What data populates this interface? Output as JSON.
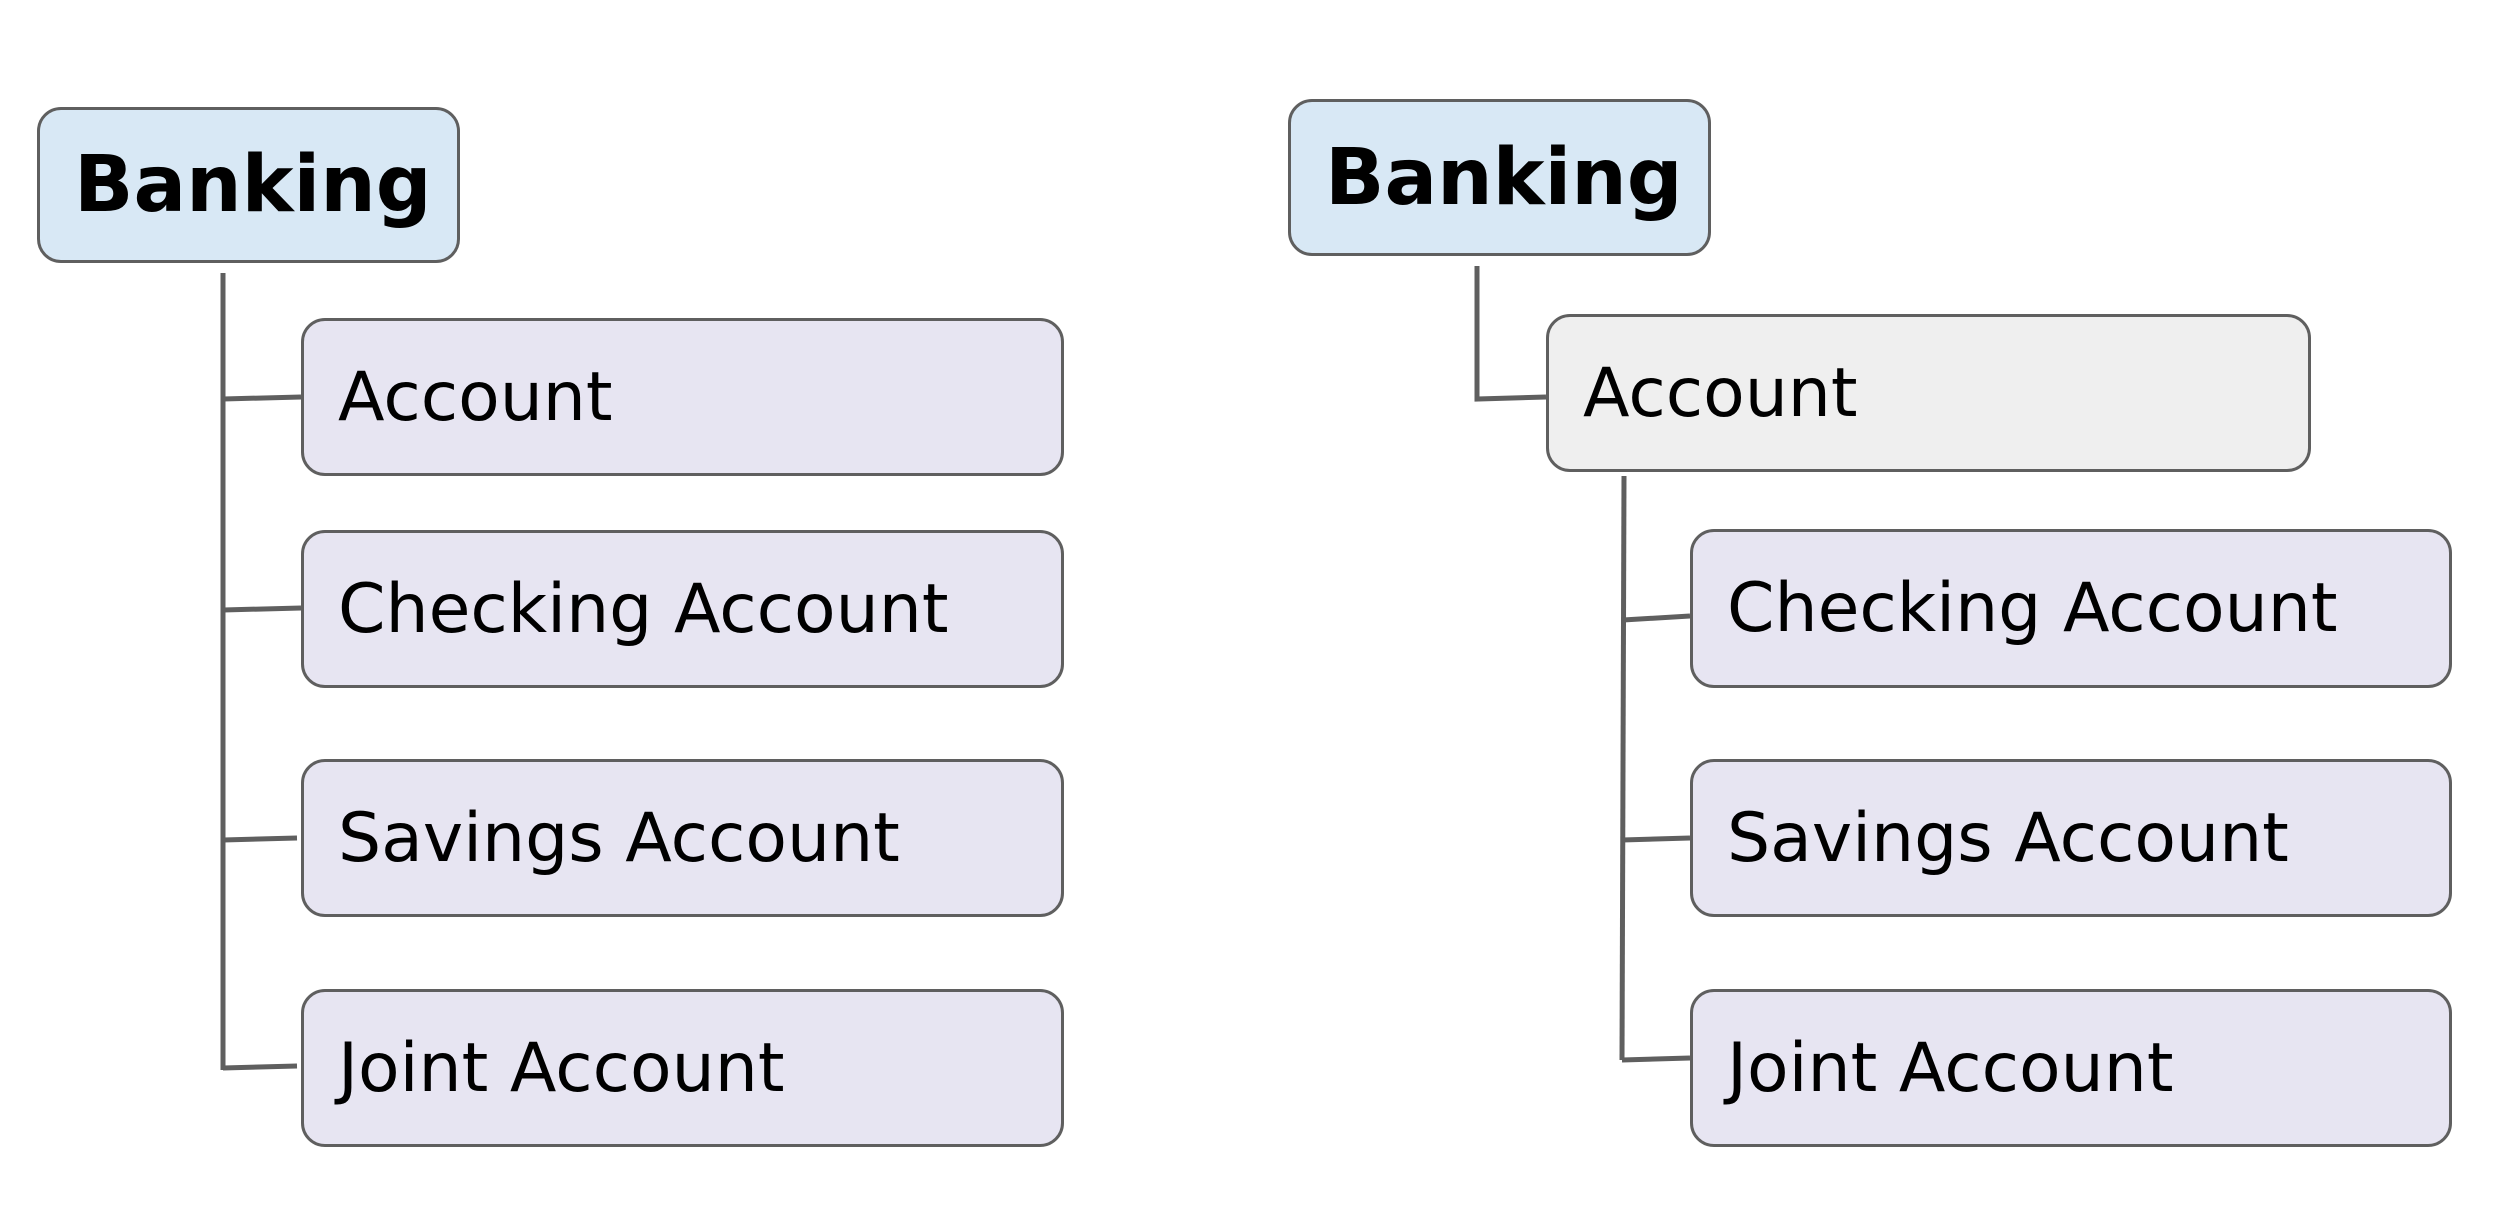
{
  "diagrams": [
    {
      "name": "flat-hierarchy",
      "root": "Banking",
      "children": [
        "Account",
        "Checking Account",
        "Savings Account",
        "Joint Account"
      ]
    },
    {
      "name": "nested-hierarchy",
      "root": "Banking",
      "child": "Account",
      "grandchildren": [
        "Checking Account",
        "Savings Account",
        "Joint Account"
      ]
    }
  ],
  "colors": {
    "root_fill": "#d8e8f5",
    "child_fill": "#e7e5f2",
    "intermediate_fill": "#efefef",
    "border": "#5f5f5f"
  }
}
